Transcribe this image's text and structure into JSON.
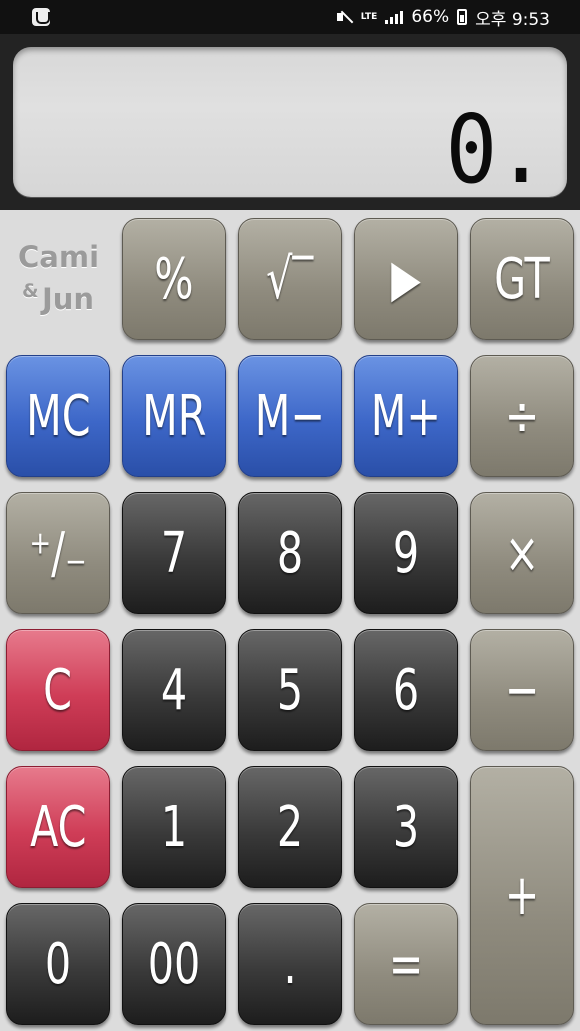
{
  "status_bar": {
    "battery": "66%",
    "time": "오후 9:53",
    "network": "LTE"
  },
  "display": {
    "value": "0."
  },
  "brand": {
    "name1": "Cami",
    "amp": "&",
    "name2": "Jun"
  },
  "keys": {
    "percent": "%",
    "sqrt": "√‾",
    "play": "▶",
    "gt": "GT",
    "mc": "MC",
    "mr": "MR",
    "m_minus": "M−",
    "m_plus": "M+",
    "divide": "÷",
    "plus_minus": "⁺∕₋",
    "seven": "7",
    "eight": "8",
    "nine": "9",
    "multiply": "×",
    "clear": "C",
    "four": "4",
    "five": "5",
    "six": "6",
    "minus": "−",
    "all_clear": "AC",
    "one": "1",
    "two": "2",
    "three": "3",
    "plus": "+",
    "zero": "0",
    "double_zero": "00",
    "decimal": ".",
    "equals": "="
  },
  "colors": {
    "gray_key": "#8f8b7e",
    "dark_key": "#3a3a3a",
    "blue_key": "#3d67c8",
    "red_key": "#cf3d57",
    "lcd": "#dcdcdc"
  }
}
